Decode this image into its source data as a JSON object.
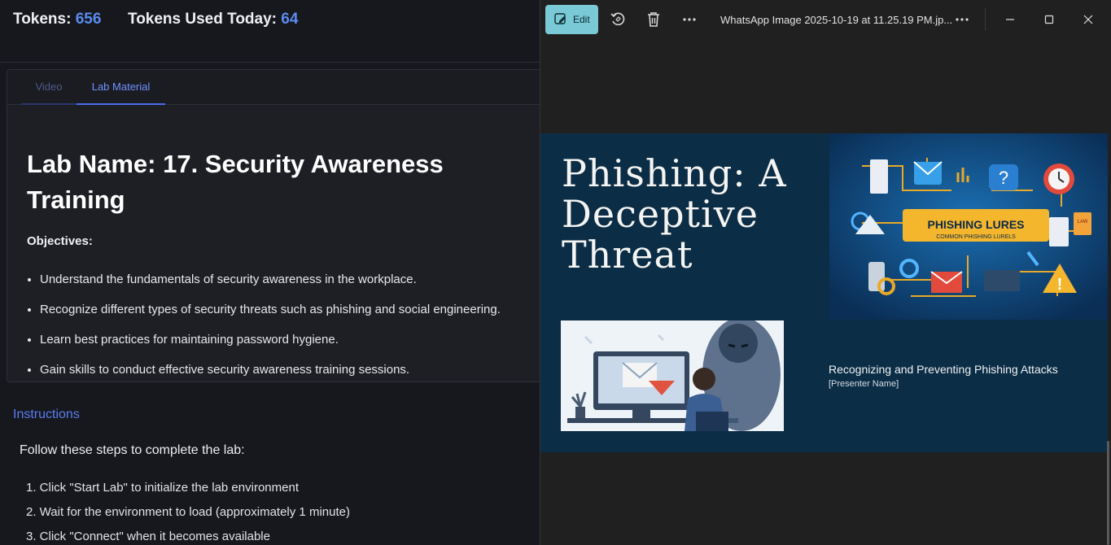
{
  "header": {
    "tokens_label": "Tokens:",
    "tokens_value": "656",
    "tokens_today_label": "Tokens Used Today:",
    "tokens_today_value": "64"
  },
  "tabs": [
    {
      "label": "Video",
      "active": false
    },
    {
      "label": "Lab Material",
      "active": true
    }
  ],
  "lab": {
    "title": "Lab Name: 17. Security Awareness Training",
    "objectives_label": "Objectives",
    "objectives_colon": ":",
    "objectives": [
      "Understand the fundamentals of security awareness in the workplace.",
      "Recognize different types of security threats such as phishing and social engineering.",
      "Learn best practices for maintaining password hygiene.",
      "Gain skills to conduct effective security awareness training sessions."
    ]
  },
  "instructions": {
    "heading": "Instructions",
    "intro": "Follow these steps to complete the lab:",
    "steps": [
      "1. Click \"Start Lab\" to initialize the lab environment",
      "2. Wait for the environment to load (approximately 1 minute)",
      "3. Click \"Connect\" when it becomes available"
    ]
  },
  "viewer": {
    "edit_label": "Edit",
    "file_name": "WhatsApp Image 2025-10-19 at 11.25.19 PM.jp...",
    "icons": [
      "edit-icon",
      "rotate-icon",
      "delete-icon",
      "more-icon",
      "more-icon",
      "minimize-icon",
      "maximize-icon",
      "close-icon"
    ],
    "accent": "#7ac9d6"
  },
  "slide": {
    "title": "Phishing: A\nDeceptive\nThreat",
    "subtitle": "Recognizing and Preventing Phishing Attacks",
    "presenter": "[Presenter Name]",
    "art_banner": "PHISHING LURES",
    "art_banner_sub": "COMMON PHISHING LURELS",
    "art_badge": "LAW",
    "background": "#0b2d46"
  }
}
